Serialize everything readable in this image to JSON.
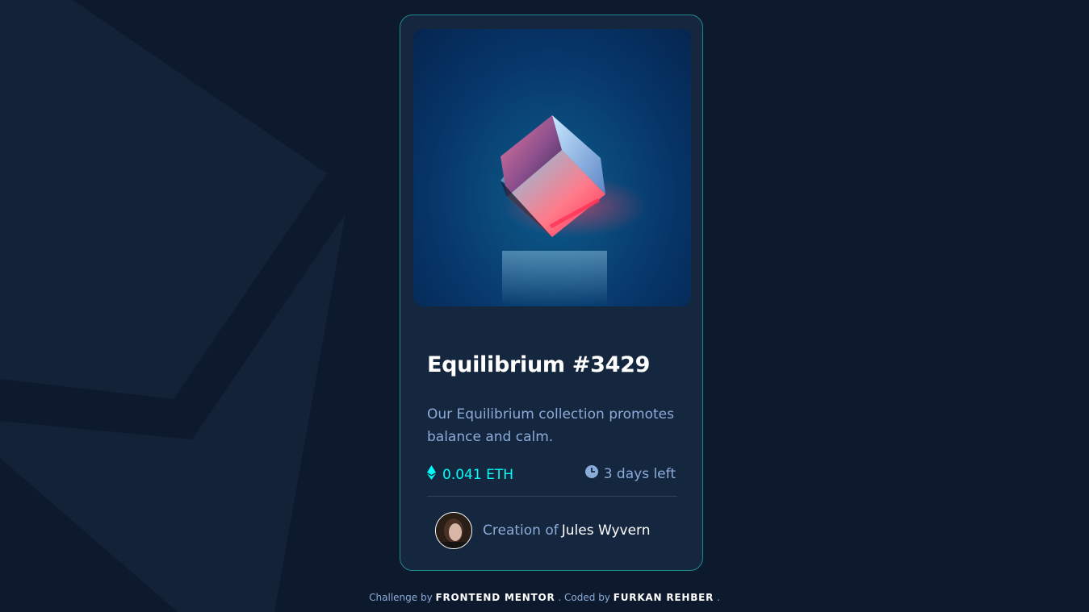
{
  "card": {
    "title": "Equilibrium #3429",
    "description": "Our Equilibrium collection promotes balance and calm.",
    "price": "0.041 ETH",
    "time_left": "3 days left",
    "creator_lead": "Creation of",
    "creator_name": "Jules Wyvern"
  },
  "footer": {
    "challenge_lead": "Challenge by",
    "challenge_by": "FRONTEND MENTOR",
    "coded_lead": ". Coded by",
    "coded_by": "FURKAN REHBER",
    "trail": "."
  },
  "icons": {
    "price": "ethereum-icon",
    "time": "clock-icon"
  },
  "colors": {
    "page_bg": "#0d192c",
    "card_bg": "#15263f",
    "card_border": "#1f8b8f",
    "accent_cyan": "#00fff8",
    "muted_text": "#8bacd9",
    "white": "#ffffff"
  }
}
